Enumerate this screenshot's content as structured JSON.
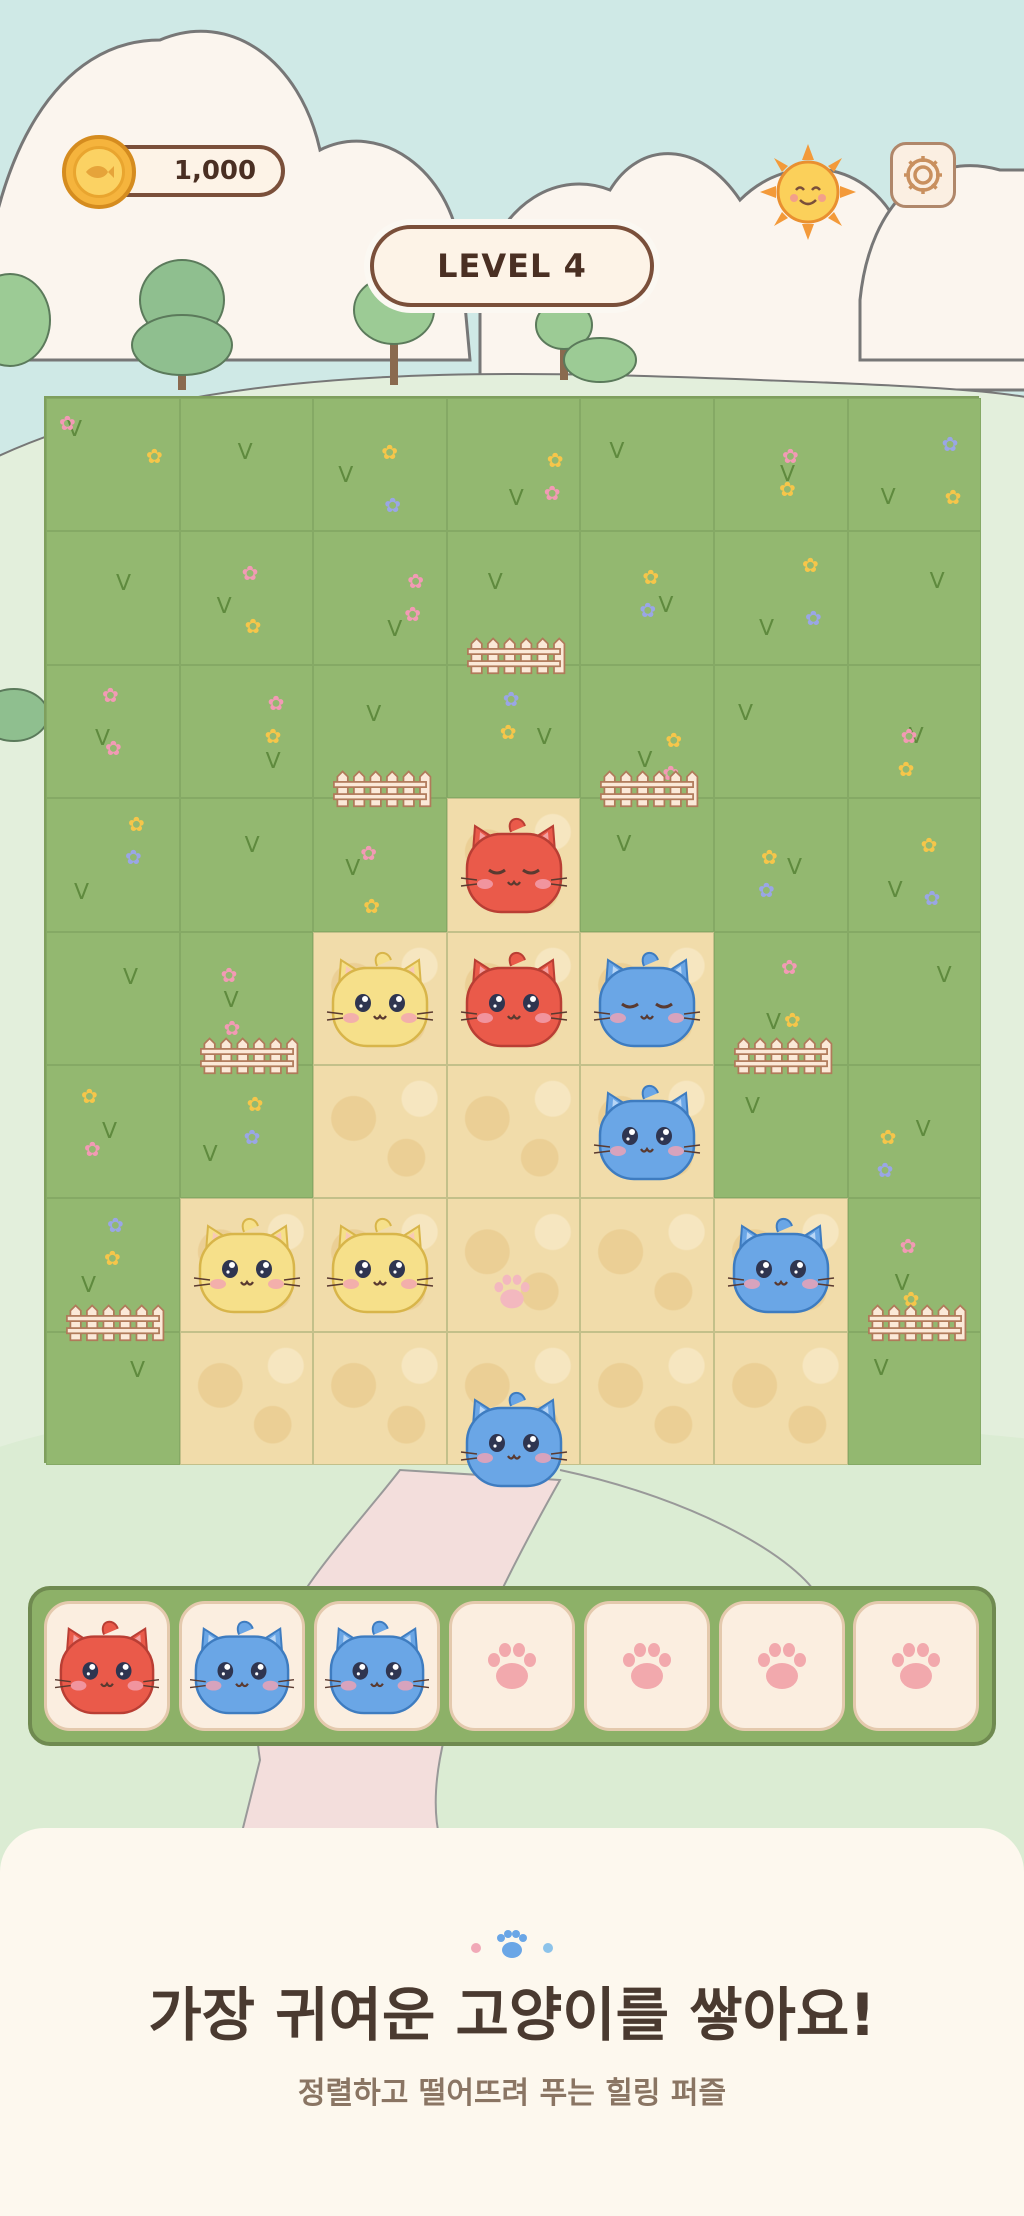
{
  "hud": {
    "coins": "1,000",
    "level": "LEVEL 4"
  },
  "footer": {
    "headline": "가장 귀여운 고양이를 쌓아요!",
    "subline": "정렬하고 떨어뜨려 푸는 힐링 퍼즐"
  },
  "colors": {
    "red_cat": "#ea5a4a",
    "blue_cat": "#6aa6e6",
    "yellow_cat": "#f6e08a",
    "grass": "#93b870",
    "sand": "#f1dcaa"
  },
  "board": {
    "cols": 7,
    "rows": 8,
    "pieces": [
      {
        "row": 3,
        "col": 3,
        "color": "red",
        "state": "sleeping"
      },
      {
        "row": 4,
        "col": 2,
        "color": "yellow",
        "state": "awake"
      },
      {
        "row": 4,
        "col": 3,
        "color": "red",
        "state": "awake"
      },
      {
        "row": 4,
        "col": 4,
        "color": "blue",
        "state": "sleeping"
      },
      {
        "row": 5,
        "col": 4,
        "color": "blue",
        "state": "awake"
      },
      {
        "row": 6,
        "col": 1,
        "color": "yellow",
        "state": "awake"
      },
      {
        "row": 6,
        "col": 2,
        "color": "yellow",
        "state": "awake"
      },
      {
        "row": 6,
        "col": 5,
        "color": "blue",
        "state": "awake"
      },
      {
        "row": 7,
        "col": 3,
        "color": "blue",
        "state": "awake",
        "note": "exiting"
      }
    ]
  },
  "tray": {
    "slots": [
      {
        "color": "red"
      },
      {
        "color": "blue"
      },
      {
        "color": "blue"
      },
      {
        "color": "empty"
      },
      {
        "color": "empty"
      },
      {
        "color": "empty"
      },
      {
        "color": "empty"
      }
    ]
  },
  "icons": {
    "coin": "fish-coin-icon",
    "settings": "gear-icon",
    "sun": "smiling-sun-icon",
    "empty_slot": "paw-print-icon"
  }
}
